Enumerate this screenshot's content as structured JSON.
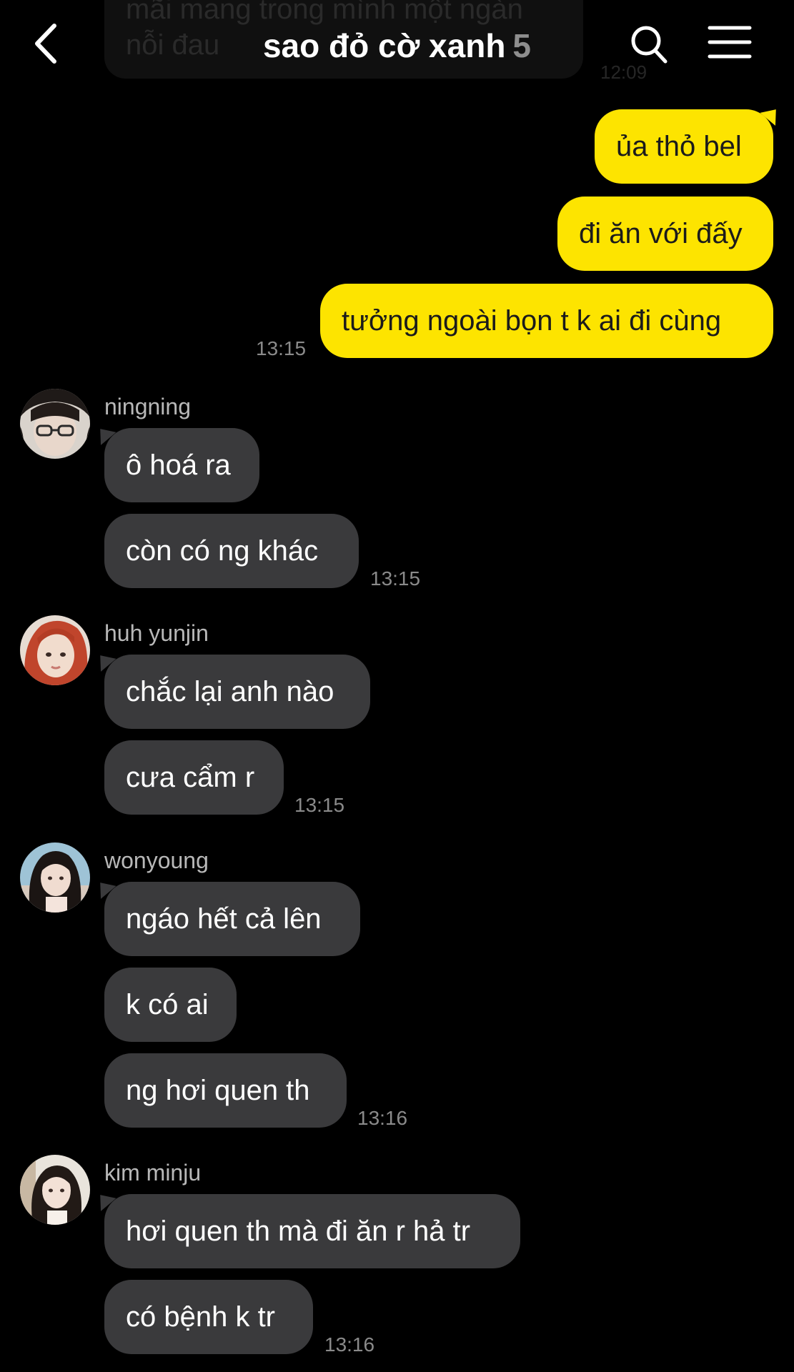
{
  "header": {
    "title": "sao đỏ cờ xanh",
    "member_count": "5",
    "previous_message_text": "mãi mang trong mình một ngàn\nnỗi đau",
    "previous_message_time": "12:09",
    "back_icon": "chevron-left-icon",
    "search_icon": "search-icon",
    "menu_icon": "hamburger-menu-icon"
  },
  "colors": {
    "background": "#000000",
    "my_bubble": "#fde400",
    "their_bubble": "#3a3a3c",
    "timestamp": "#8a8a8a",
    "sender_name": "#b8b8b8"
  },
  "my_group": {
    "messages": [
      {
        "text": "ủa thỏ bel"
      },
      {
        "text": "đi ăn với đấy"
      },
      {
        "text": "tưởng ngoài bọn t k ai đi cùng"
      }
    ],
    "time": "13:15"
  },
  "groups": [
    {
      "sender": "ningning",
      "messages": [
        {
          "text": "ô hoá ra"
        },
        {
          "text": "còn có ng khác"
        }
      ],
      "time": "13:15"
    },
    {
      "sender": "huh yunjin",
      "messages": [
        {
          "text": "chắc lại anh nào"
        },
        {
          "text": "cưa cẩm r"
        }
      ],
      "time": "13:15"
    },
    {
      "sender": "wonyoung",
      "messages": [
        {
          "text": "ngáo hết cả lên"
        },
        {
          "text": "k có ai"
        },
        {
          "text": "ng hơi quen th"
        }
      ],
      "time": "13:16"
    },
    {
      "sender": "kim minju",
      "messages": [
        {
          "text": "hơi quen th mà đi ăn r hả tr"
        },
        {
          "text": "có bệnh k tr"
        }
      ],
      "time": "13:16"
    }
  ]
}
